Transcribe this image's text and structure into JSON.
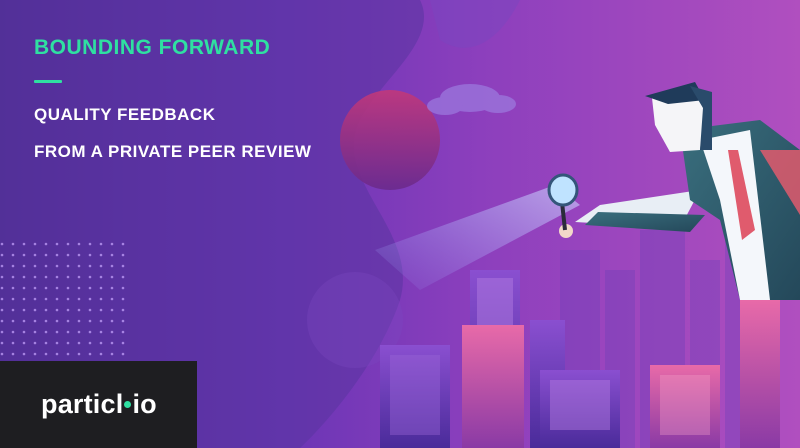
{
  "headline": "BOUNDING FORWARD",
  "subtitle_line1": "QUALITY FEEDBACK",
  "subtitle_line2": "FROM A PRIVATE PEER REVIEW",
  "logo": {
    "part1": "particl",
    "part2": "io"
  },
  "colors": {
    "accent": "#2fe0a1",
    "background_left": "#4b2a8f",
    "background_right": "#b04fbf",
    "logo_box": "#1e1e21",
    "text": "#ffffff"
  }
}
